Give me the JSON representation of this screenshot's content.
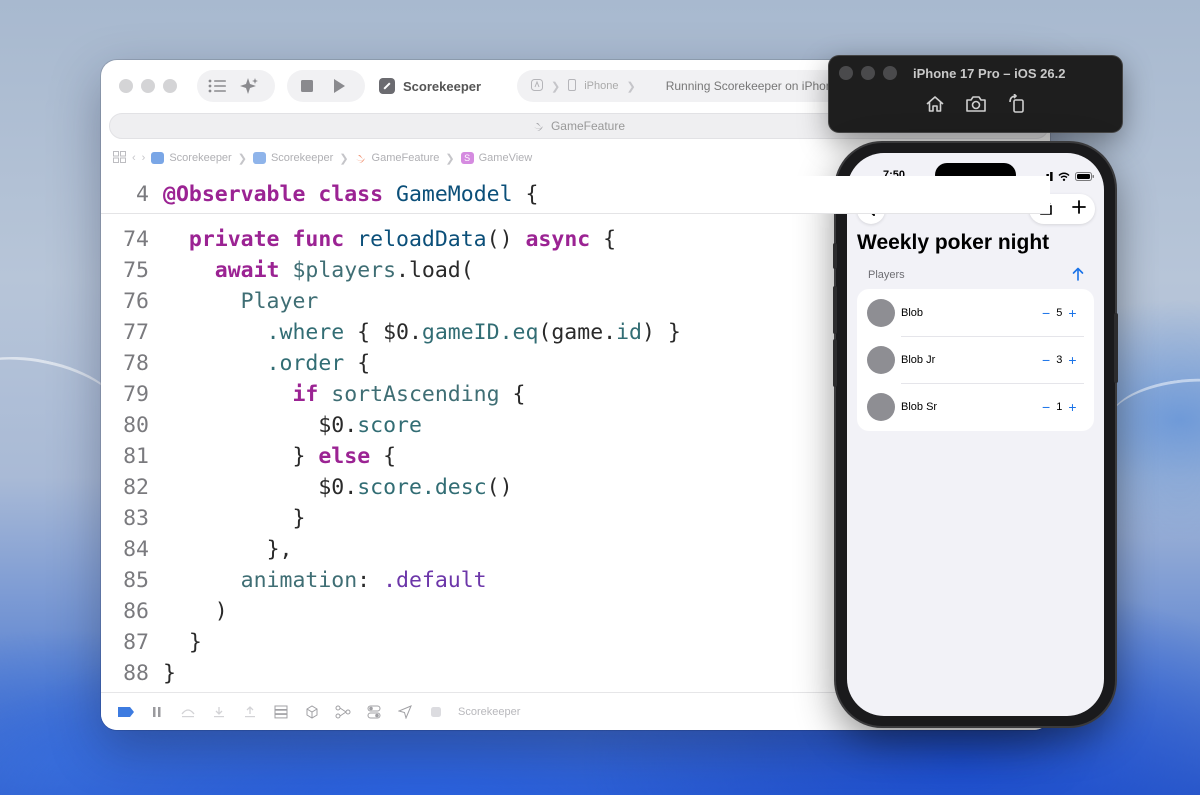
{
  "xcode": {
    "scheme": "Scorekeeper",
    "destination_device": "iPhone",
    "status": "Running Scorekeeper on iPhone",
    "tab": "GameFeature",
    "breadcrumbs": [
      "Scorekeeper",
      "Scorekeeper",
      "GameFeature",
      "GameView"
    ],
    "sticky_line": {
      "num": "4"
    },
    "code": [
      {
        "num": "74"
      },
      {
        "num": "75"
      },
      {
        "num": "76"
      },
      {
        "num": "77"
      },
      {
        "num": "78"
      },
      {
        "num": "79"
      },
      {
        "num": "80"
      },
      {
        "num": "81"
      },
      {
        "num": "82"
      },
      {
        "num": "83"
      },
      {
        "num": "84"
      },
      {
        "num": "85"
      },
      {
        "num": "86"
      },
      {
        "num": "87"
      },
      {
        "num": "88"
      }
    ],
    "tokens": {
      "observable": "@Observable",
      "class": "class",
      "game_model": "GameModel",
      "brace_open": "{",
      "private": "private",
      "func": "func",
      "reload_data": "reloadData",
      "parens": "()",
      "async": "async",
      "await": "await",
      "players_load": "$players",
      "load": ".load(",
      "player": "Player",
      "where": ".where",
      "where_body_open": " { $0.",
      "game_id": "gameID",
      "eq": ".eq",
      "game_id_arg": "(game.",
      "id": "id",
      "where_close": ") }",
      "order": ".order",
      "if": "if",
      "sort_ascending": "sortAscending",
      "dollar0": "$0.",
      "score": "score",
      "close_brace": "}",
      "else": "else",
      "desc": ".desc",
      "call_close": "()",
      "closure_close": "},",
      "animation": "animation",
      "colon": ": ",
      "default": ".default",
      "paren_close": ")"
    },
    "debug_target": "Scorekeeper"
  },
  "simulator": {
    "title": "iPhone 17 Pro – iOS 26.2",
    "icons": [
      "home-icon",
      "screenshot-icon",
      "rotate-icon"
    ]
  },
  "phone": {
    "time": "7:50",
    "title": "Weekly poker night",
    "section_label": "Players",
    "players": [
      {
        "name": "Blob",
        "score": "5"
      },
      {
        "name": "Blob Jr",
        "score": "3"
      },
      {
        "name": "Blob Sr",
        "score": "1"
      }
    ],
    "minus": "−",
    "plus": "+"
  },
  "colors": {
    "keyword": "#9b2393",
    "type": "#0b4f79",
    "function": "#326d74",
    "accent": "#1a73e8"
  }
}
